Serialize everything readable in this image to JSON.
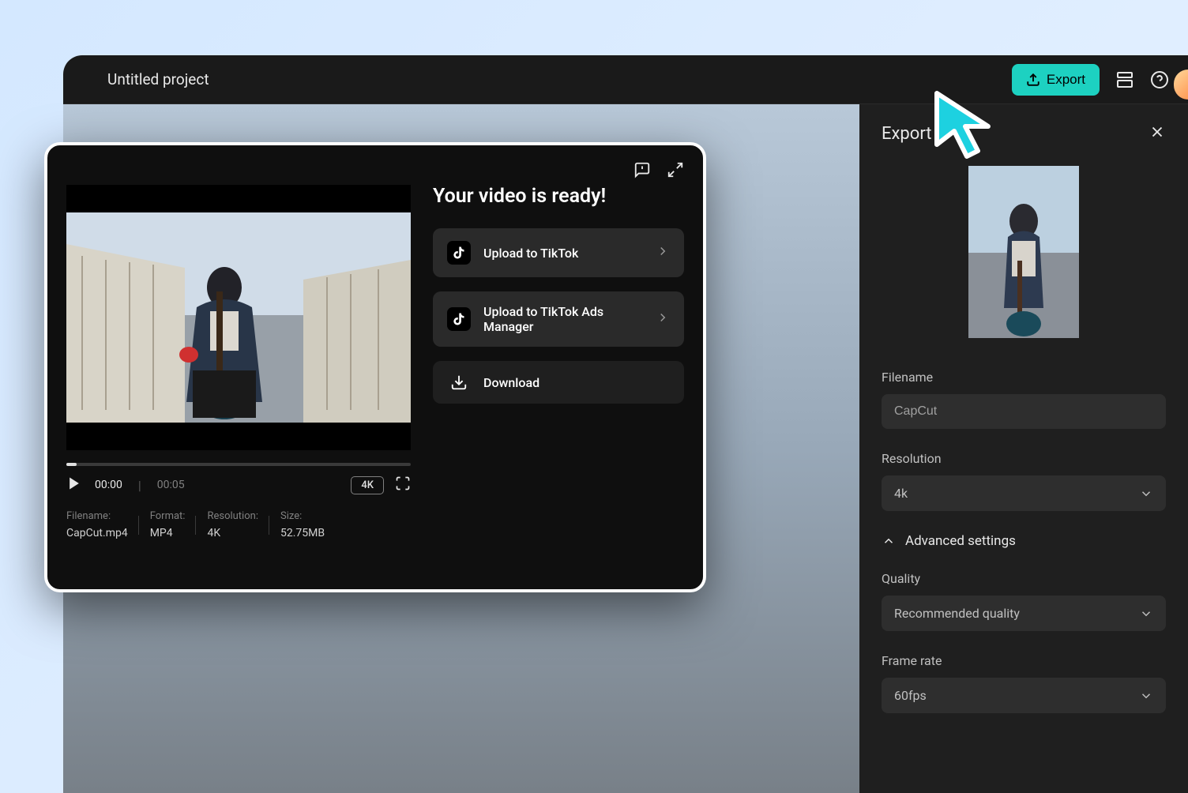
{
  "header": {
    "project_title": "Untitled project",
    "export_label": "Export"
  },
  "export_panel": {
    "title": "Export",
    "filename_label": "Filename",
    "filename_value": "CapCut",
    "resolution_label": "Resolution",
    "resolution_value": "4k",
    "advanced_label": "Advanced settings",
    "quality_label": "Quality",
    "quality_value": "Recommended quality",
    "framerate_label": "Frame rate",
    "framerate_value": "60fps"
  },
  "dialog": {
    "ready_title": "Your video is ready!",
    "actions": {
      "tiktok": "Upload to TikTok",
      "tiktok_ads": "Upload to TikTok Ads Manager",
      "download": "Download"
    },
    "playback": {
      "current": "00:00",
      "duration": "00:05",
      "badge": "4K"
    },
    "info": {
      "filename_label": "Filename:",
      "filename_value": "CapCut.mp4",
      "format_label": "Format:",
      "format_value": "MP4",
      "resolution_label": "Resolution:",
      "resolution_value": "4K",
      "size_label": "Size:",
      "size_value": "52.75MB"
    }
  }
}
